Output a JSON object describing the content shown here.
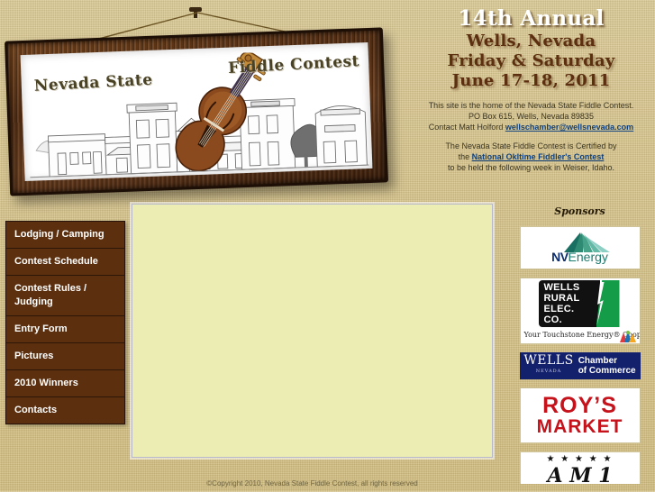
{
  "site": {
    "title": "Nevada State Fiddle Contest"
  },
  "banner": {
    "sign_title_left": "Nevada State",
    "sign_title_right": "Fiddle Contest",
    "alt": "Framed sign showing Wells Nevada townscape sketch with a fiddle"
  },
  "header": {
    "annual": "14th Annual",
    "place": "Wells, Nevada",
    "days": "Friday & Saturday",
    "date": "June 17-18, 2011",
    "info_line1": "This site is the home of the Nevada State Fiddle Contest.",
    "info_line2": "PO Box 615, Wells, Nevada 89835",
    "contact_prefix": "Contact Matt Holford ",
    "contact_email": "wellschamber@wellsnevada.com",
    "cert_line1": "The Nevada State Fiddle Contest is Certified by",
    "cert_prefix": "the ",
    "cert_link": "National Okltime Fiddler's Contest",
    "cert_line3": "to be held the following week in Weiser, Idaho."
  },
  "nav": {
    "items": [
      {
        "label": "Lodging / Camping"
      },
      {
        "label": "Contest Schedule"
      },
      {
        "label": "Contest Rules / Judging"
      },
      {
        "label": "Entry Form"
      },
      {
        "label": "Pictures"
      },
      {
        "label": "2010 Winners"
      },
      {
        "label": "Contacts"
      }
    ]
  },
  "content": {
    "body": ""
  },
  "sponsors": {
    "title": "Sponsors",
    "items": [
      {
        "name": "NV Energy",
        "nv": "NV",
        "energy": "Energy"
      },
      {
        "name": "Wells Rural Elec. Co.",
        "line1": "WELLS",
        "line2": "RURAL",
        "line3": "ELEC.",
        "line4": "CO.",
        "tagline": "Your Touchstone Energy® Cooperative"
      },
      {
        "name": "Wells Nevada Chamber of Commerce",
        "wells": "WELLS",
        "nevada": "NEVADA",
        "chamber_line1": "Chamber",
        "chamber_line2": "of Commerce"
      },
      {
        "name": "Roy's Market",
        "line1": "ROY’S",
        "line2": "MARKET"
      },
      {
        "name": "Sponsor logo with stars",
        "stars": "★ ★ ★ ★ ★",
        "script": "A  M  1"
      }
    ]
  },
  "footer": {
    "copyright": "©Copyright 2010, Nevada State Fiddle Contest, all rights reserved"
  },
  "colors": {
    "page_background": "#d4bf82",
    "nav_item": "#5c300f",
    "nav_border": "#2c1607",
    "content_panel": "#ecedb2",
    "link": "#10407a",
    "header_place_text": "#5b2f10",
    "header_annual_text": "#ffffff",
    "nv_energy_blue": "#0e2d6b",
    "nv_energy_teal": "#1c7b6e",
    "wrec_green": "#149c49",
    "chamber_blue": "#13206b",
    "roys_red": "#c6121b",
    "footer_text": "#6f6540"
  }
}
